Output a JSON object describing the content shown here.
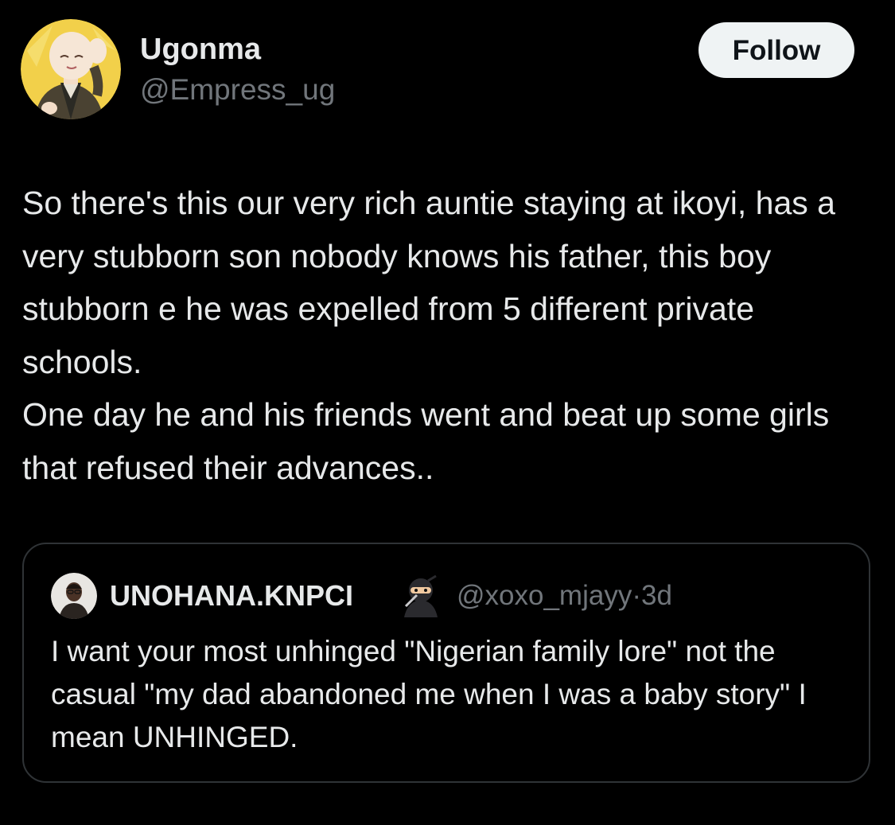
{
  "tweet": {
    "author": {
      "name": "Ugonma",
      "handle": "@Empress_ug",
      "avatar_icon": "cartoon-avatar-icon"
    },
    "follow_label": "Follow",
    "text": "So there's this our very rich auntie staying at ikoyi, has a very stubborn son nobody knows his father, this boy stubborn e he was expelled from 5 different private schools.\nOne day he and his friends went and beat up some girls that refused their advances..",
    "quoted": {
      "name": "UNOHANA.KNPCI",
      "name_emoji": "ninja-emoji-icon",
      "handle": "@xoxo_mjayy",
      "separator": "·",
      "time": "3d",
      "text": "I want your most unhinged \"Nigerian family lore\" not the casual \"my dad abandoned me when I was a baby story\" I mean UNHINGED."
    }
  },
  "colors": {
    "background": "#000000",
    "primary_text": "#e7e9ea",
    "secondary_text": "#71767b",
    "border": "#2f3336",
    "follow_button_bg": "#eff3f4",
    "follow_button_text": "#0f1419"
  }
}
